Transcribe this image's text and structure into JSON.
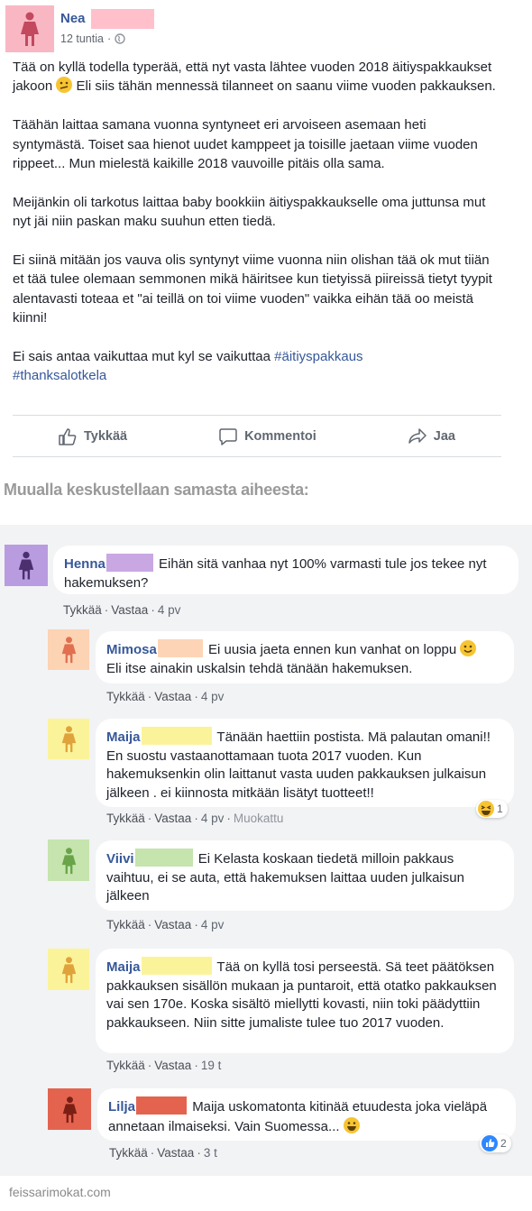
{
  "post": {
    "author": "Nea",
    "time": "12 tuntia",
    "paragraphs": [
      "Tää on kyllä todella typerää, että nyt vasta lähtee vuoden 2018 äitiyspakkaukset jakoon",
      "Eli siis tähän mennessä tilanneet on saanu viime vuoden pakkauksen.",
      "Täähän laittaa samana vuonna syntyneet eri arvoiseen asemaan heti syntymästä. Toiset saa hienot uudet kamppeet ja toisille jaetaan viime vuoden rippeet... Mun mielestä kaikille 2018 vauvoille pitäis olla sama.",
      "Meijänkin oli tarkotus laittaa baby bookkiin äitiyspakkaukselle oma juttunsa mut nyt jäi niin paskan maku suuhun etten tiedä.",
      "Ei siinä mitään jos vauva olis syntynyt viime vuonna niin olishan tää ok mut tiiän et tää tulee olemaan semmonen mikä häiritsee kun tietyissä piireissä tietyt tyypit alentavasti toteaa et \"ai teillä on toi viime vuoden\" vaikka eihän tää oo meistä kiinni!",
      "Ei sais antaa vaikuttaa mut kyl se vaikuttaa"
    ],
    "hashtags": [
      "#äitiyspakkaus",
      "#thanksalotkela"
    ],
    "actions": {
      "like": "Tykkää",
      "comment": "Kommentoi",
      "share": "Jaa"
    }
  },
  "section_title": "Muualla keskustellaan samasta aiheesta:",
  "comment_labels": {
    "like": "Tykkää",
    "reply": "Vastaa"
  },
  "comments": [
    {
      "author": "Henna",
      "text": "Eihän sitä vanhaa nyt 100% varmasti tule jos tekee nyt hakemuksen?",
      "time": "4 pv",
      "edited": "",
      "reaction_count": ""
    },
    {
      "author": "Mimosa",
      "text": "Ei uusia jaeta ennen kun vanhat on loppu",
      "text2": "Eli itse ainakin uskalsin tehdä tänään hakemuksen.",
      "time": "4 pv",
      "edited": "",
      "reaction_count": ""
    },
    {
      "author": "Maija",
      "text": "Tänään haettiin postista. Mä palautan omani!! En suostu vastaanottamaan tuota 2017 vuoden. Kun hakemuksenkin olin laittanut vasta uuden pakkauksen julkaisun jälkeen . ei kiinnosta mitkään lisätyt tuotteet!!",
      "time": "4 pv",
      "edited": "Muokattu",
      "reaction_count": "1"
    },
    {
      "author": "Viivi",
      "text": "Ei Kelasta koskaan tiedetä milloin pakkaus vaihtuu, ei se auta, että hakemuksen laittaa uuden julkaisun jälkeen",
      "time": "4 pv",
      "edited": "",
      "reaction_count": ""
    },
    {
      "author": "Maija",
      "text": "Tää on kyllä tosi perseestä. Sä teet päätöksen pakkauksen sisällön mukaan ja puntaroit, että otatko pakkauksen vai sen 170e. Koska sisältö miellytti kovasti, niin toki päädyttiin pakkaukseen. Niin sitte jumaliste tulee tuo 2017 vuoden.",
      "time": "19 t",
      "edited": "",
      "reaction_count": ""
    },
    {
      "author": "Lilja",
      "text": "Maija uskomatonta kitinää etuudesta joka vieläpä annetaan ilmaiseksi. Vain Suomessa...",
      "time": "3 t",
      "edited": "",
      "reaction_count": "2"
    }
  ],
  "footer": "feissarimokat.com",
  "colors": {
    "link": "#365899",
    "avatar_nea": "#f9b7c4",
    "avatar_henna": "#b99be0",
    "avatar_mimosa": "#fcd3b3",
    "avatar_maija": "#fbf39a",
    "avatar_viivi": "#c6e4ae",
    "avatar_lilja": "#e4634f",
    "comments_bg": "#f2f3f5"
  }
}
